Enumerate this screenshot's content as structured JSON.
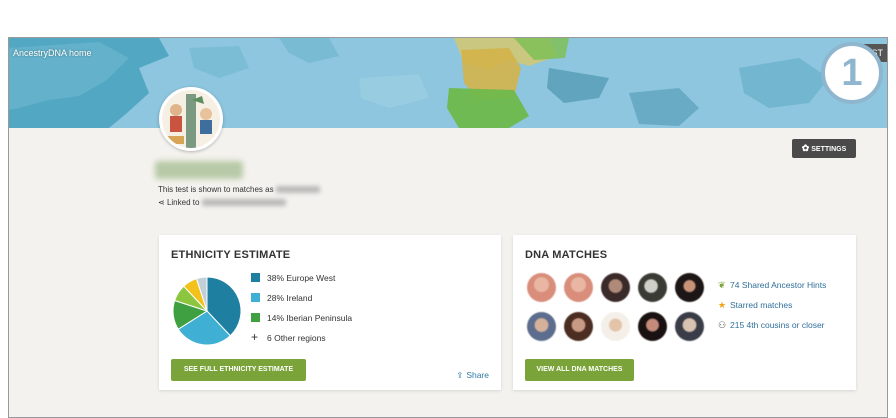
{
  "header": {
    "home_link": "AncestryDNA home",
    "test_pill": "ST",
    "step_number": "1"
  },
  "profile": {
    "shown_text": "This test is shown to matches as",
    "linked_text": "Linked to",
    "settings_label": "SETTINGS",
    "settings_icon": "gear-icon"
  },
  "ethnicity": {
    "title": "ETHNICITY ESTIMATE",
    "regions": [
      {
        "label": "38% Europe West",
        "color": "#1f7fa0",
        "percent": 38
      },
      {
        "label": "28% Ireland",
        "color": "#3fb0d3",
        "percent": 28
      },
      {
        "label": "14% Iberian Peninsula",
        "color": "#3fa041",
        "percent": 14
      }
    ],
    "other_label": "6 Other regions",
    "other_slices": [
      {
        "color": "#8cc63f",
        "percent": 8
      },
      {
        "color": "#f2c21b",
        "percent": 7
      },
      {
        "color": "#c0cfd8",
        "percent": 5
      }
    ],
    "button_label": "SEE FULL ETHNICITY ESTIMATE",
    "share_label": "Share",
    "share_icon": "share-icon"
  },
  "dna_matches": {
    "title": "DNA MATCHES",
    "hints": [
      {
        "label": "74 Shared Ancestor Hints",
        "icon": "leaf-icon",
        "color": "#7aa43a"
      },
      {
        "label": "Starred matches",
        "icon": "star-icon",
        "color": "#f0a21c"
      },
      {
        "label": "215 4th cousins or closer",
        "icon": "people-icon",
        "color": "#555555"
      }
    ],
    "button_label": "VIEW ALL DNA MATCHES"
  }
}
